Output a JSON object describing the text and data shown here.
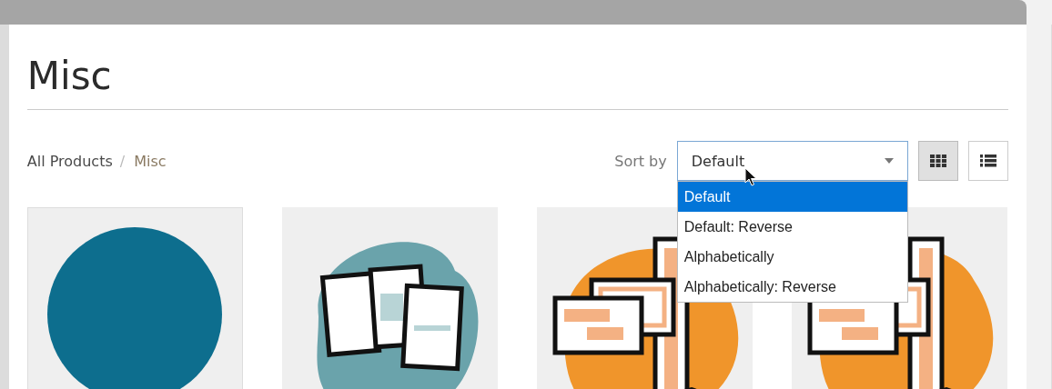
{
  "page_title": "Misc",
  "breadcrumb_separator": "/",
  "breadcrumb": [
    {
      "label": "All Products",
      "selected": false
    },
    {
      "label": "Misc",
      "selected": true
    }
  ],
  "sort": {
    "label": "Sort by",
    "value": "Default",
    "expanded": true,
    "options": [
      {
        "label": "Default",
        "selected": true
      },
      {
        "label": "Default: Reverse",
        "selected": false
      },
      {
        "label": "Alphabetically",
        "selected": false
      },
      {
        "label": "Alphabetically: Reverse",
        "selected": false
      }
    ]
  },
  "view_buttons": [
    {
      "kind": "grid",
      "selected": true
    },
    {
      "kind": "list",
      "selected": false
    }
  ]
}
